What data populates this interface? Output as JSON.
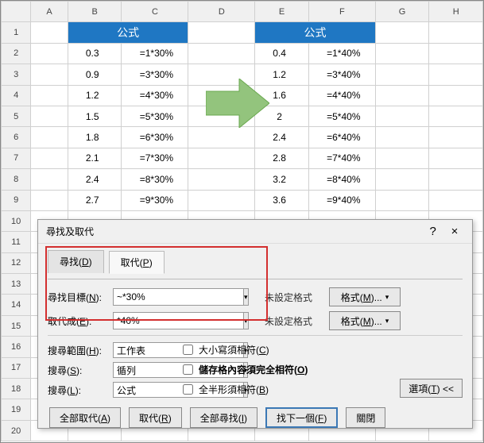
{
  "columns": [
    "A",
    "B",
    "C",
    "D",
    "E",
    "F",
    "G",
    "H"
  ],
  "rowCount": 20,
  "tableHeader": "公式",
  "leftTable": [
    {
      "v": "0.3",
      "f": "=1*30%"
    },
    {
      "v": "0.9",
      "f": "=3*30%"
    },
    {
      "v": "1.2",
      "f": "=4*30%"
    },
    {
      "v": "1.5",
      "f": "=5*30%"
    },
    {
      "v": "1.8",
      "f": "=6*30%"
    },
    {
      "v": "2.1",
      "f": "=7*30%"
    },
    {
      "v": "2.4",
      "f": "=8*30%"
    },
    {
      "v": "2.7",
      "f": "=9*30%"
    }
  ],
  "rightTable": [
    {
      "v": "0.4",
      "f": "=1*40%"
    },
    {
      "v": "1.2",
      "f": "=3*40%"
    },
    {
      "v": "1.6",
      "f": "=4*40%"
    },
    {
      "v": "2",
      "f": "=5*40%"
    },
    {
      "v": "2.4",
      "f": "=6*40%"
    },
    {
      "v": "2.8",
      "f": "=7*40%"
    },
    {
      "v": "3.2",
      "f": "=8*40%"
    },
    {
      "v": "3.6",
      "f": "=9*40%"
    }
  ],
  "dialog": {
    "title": "尋找及取代",
    "help": "?",
    "close": "×",
    "tabs": {
      "find": "尋找(D)",
      "replace": "取代(P)"
    },
    "findLabel": "尋找目標(N):",
    "findValue": "~*30%",
    "replaceLabel": "取代成(E):",
    "replaceValue": "*40%",
    "noFormat": "未設定格式",
    "formatBtn": "格式(M)...",
    "scopeLabel": "搜尋範圍(H):",
    "scopeValue": "工作表",
    "searchLabel": "搜尋(S):",
    "searchValue": "循列",
    "lookinLabel": "搜尋(L):",
    "lookinValue": "公式",
    "chkCase": "大小寫須相符(C)",
    "chkEntire": "儲存格內容須完全相符(O)",
    "chkWidth": "全半形須相符(B)",
    "optionsBtn": "選項(T) <<",
    "btnReplaceAll": "全部取代(A)",
    "btnReplace": "取代(R)",
    "btnFindAll": "全部尋找(I)",
    "btnFindNext": "找下一個(F)",
    "btnClose": "關閉"
  }
}
